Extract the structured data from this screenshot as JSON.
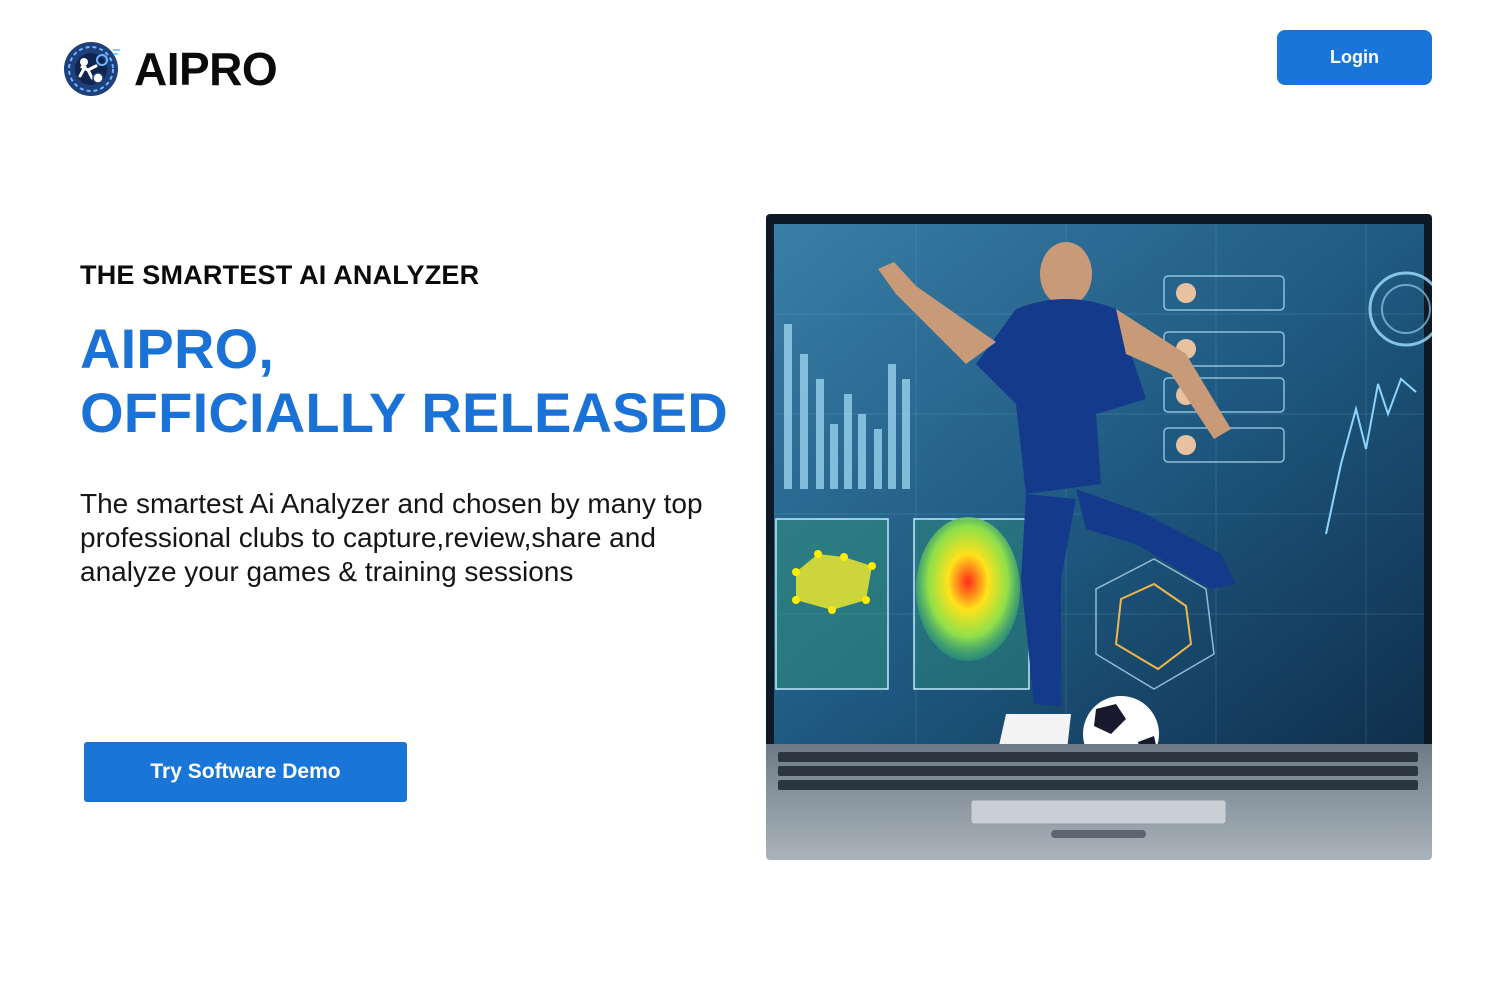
{
  "brand": {
    "name": "AIPRO",
    "logo_icon": "soccer-analytics-logo-icon"
  },
  "header": {
    "login_label": "Login"
  },
  "hero": {
    "eyebrow": "THE SMARTEST AI ANALYZER",
    "headline_line1": "AIPRO,",
    "headline_line2": "OFFICIALLY RELEASED",
    "description": "The smartest Ai Analyzer and chosen by many top professional clubs to capture,review,share and analyze your games & training sessions",
    "cta_label": "Try Software Demo",
    "image_subject": "soccer-player-laptop-analytics-image"
  },
  "colors": {
    "accent": "#1976d8",
    "headline": "#1a72d6",
    "text": "#0b0b0b"
  }
}
